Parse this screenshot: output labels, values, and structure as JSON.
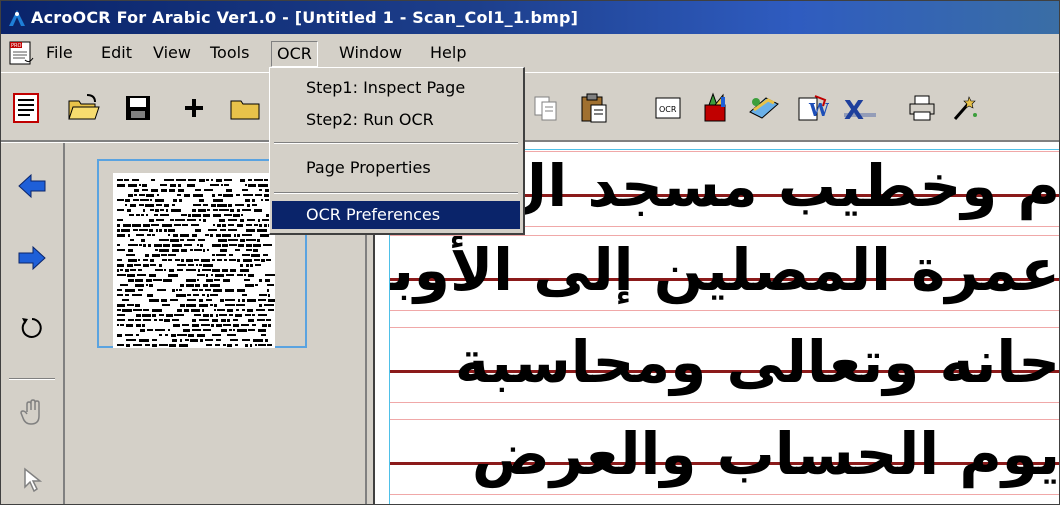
{
  "window": {
    "title": "AcroOCR For Arabic Ver1.0 - [Untitled 1 - Scan_Col1_1.bmp]"
  },
  "menubar": {
    "items": [
      "File",
      "Edit",
      "View",
      "Tools",
      "OCR",
      "Window",
      "Help"
    ],
    "active": "OCR"
  },
  "ocr_menu": {
    "items": [
      "Step1: Inspect Page",
      "Step2: Run OCR",
      "Page Properties",
      "OCR Preferences"
    ],
    "highlighted": "OCR Preferences"
  },
  "toolbar": {
    "icons": [
      "document-view-icon",
      "open-folder-icon",
      "save-icon",
      "add-icon",
      "folder-icon",
      "copy-icon",
      "paste-icon",
      "ocr-icon",
      "paint-icon",
      "scan-icon",
      "word-export-icon",
      "excel-export-icon",
      "print-icon",
      "magic-wand-icon"
    ]
  },
  "left_tools": {
    "icons": [
      "arrow-left-icon",
      "arrow-right-icon",
      "rotate-icon",
      "hand-icon",
      "pointer-icon"
    ]
  },
  "document": {
    "lines": [
      "م وخطيب مسجد ال",
      "عمرة المصلين إلى الأوبة",
      "حانه وتعالى ومحاسبة",
      "يوم الحساب والعرض"
    ]
  },
  "colors": {
    "titlebar": "#0a246a",
    "highlight": "#0a246a",
    "baseline": "#8b1a1a",
    "line_box": "#f0a8a8",
    "thumb_frame": "#5aa3e0"
  }
}
